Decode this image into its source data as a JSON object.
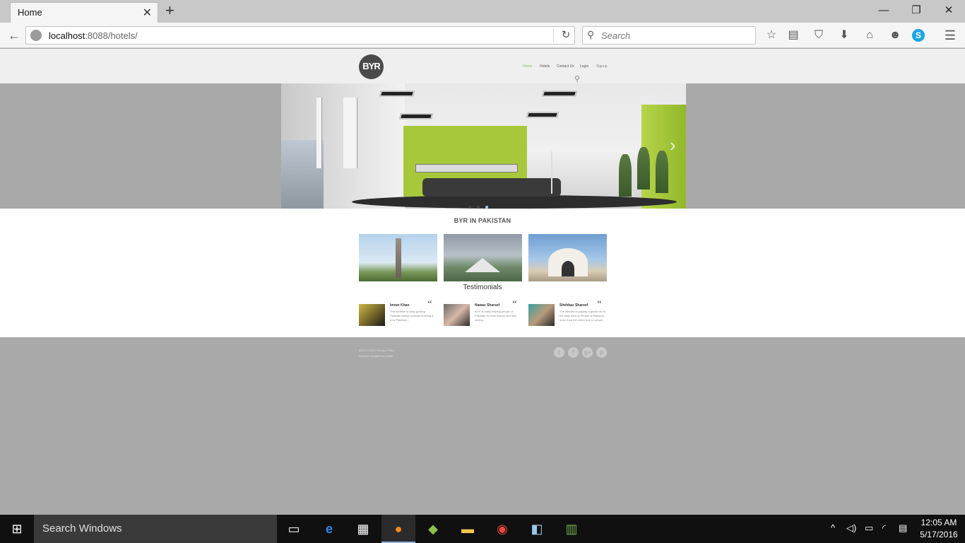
{
  "browser": {
    "tab_title": "Home",
    "tab_close": "✕",
    "new_tab": "+",
    "window_controls": {
      "minimize": "—",
      "maximize": "❐",
      "close": "✕"
    },
    "back": "←",
    "reload": "↻",
    "url_host": "localhost",
    "url_rest": ":8088/hotels/",
    "search_placeholder": "Search",
    "toolbar_icons": [
      "bookmark-star-icon",
      "reading-list-icon",
      "pocket-icon",
      "download-icon",
      "home-icon",
      "chat-icon",
      "skype-icon",
      "menu-icon"
    ],
    "toolbar_glyphs": [
      "☆",
      "▤",
      "⛉",
      "⬇",
      "⌂",
      "☻",
      "S",
      "☰"
    ]
  },
  "site": {
    "logo": "BYR",
    "nav": [
      "Home",
      "Hotels",
      "Contact Us",
      "Login",
      "Signup"
    ],
    "nav_active": "Home",
    "section_title": "BYR IN PAKISTAN",
    "testimonials_title": "Testimonials",
    "testimonials": [
      {
        "name": "Imran Khan",
        "text": "This website is fairly guiding Pakistan Nation towards building a new Pakistan..."
      },
      {
        "name": "Nawaz Shareef",
        "text": "BYR is really helping people of Pakistan for their history and time saving..."
      },
      {
        "name": "Shehbaz Shareef",
        "text": "The website is playing a great role in the daily lives of People of Pakistan more than the metro bus in Lahore."
      }
    ],
    "footer_line1": "BYR © 2016 | Privacy Policy",
    "footer_line2": "Website designed by NUMI",
    "social": [
      {
        "icon": "twitter-icon",
        "glyph": "t"
      },
      {
        "icon": "facebook-icon",
        "glyph": "f"
      },
      {
        "icon": "google-plus-icon",
        "glyph": "g+"
      },
      {
        "icon": "pinterest-icon",
        "glyph": "p"
      }
    ],
    "slider_dots": 3,
    "slider_active_dot": 3
  },
  "taskbar": {
    "search_text": "Search Windows",
    "apps": [
      "task-view-icon",
      "edge-icon",
      "store-icon",
      "firefox-icon",
      "android-studio-icon",
      "file-explorer-icon",
      "chrome-icon",
      "virtualbox-icon",
      "app-icon"
    ],
    "time": "12:05 AM",
    "date": "5/17/2016"
  }
}
